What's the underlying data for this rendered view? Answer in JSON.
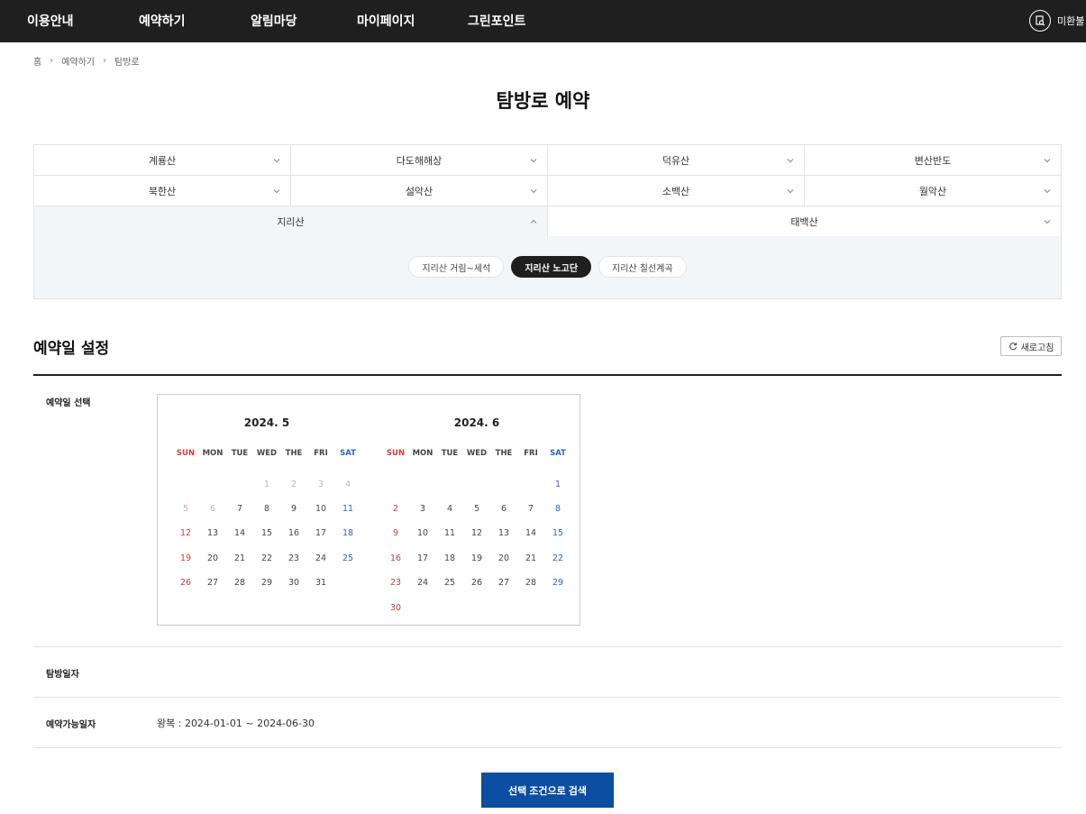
{
  "nav": {
    "items": [
      "이용안내",
      "예약하기",
      "알림마당",
      "마이페이지",
      "그린포인트"
    ],
    "user_label": "미환불"
  },
  "breadcrumb": [
    "홈",
    "예약하기",
    "탐방로"
  ],
  "page_title": "탐방로 예약",
  "mountains": {
    "rows": [
      [
        "계룡산",
        "다도해해상",
        "덕유산",
        "변산반도"
      ],
      [
        "북한산",
        "설악산",
        "소백산",
        "월악산"
      ],
      [
        "지리산",
        "태백산"
      ]
    ],
    "active": "지리산"
  },
  "sub_trails": {
    "items": [
      "지리산 거림~세석",
      "지리산 노고단",
      "지리산 칠선계곡"
    ],
    "active": "지리산 노고단"
  },
  "section": {
    "title": "예약일 설정",
    "refresh_label": "새로고침",
    "date_select_label": "예약일 선택",
    "visit_date_label": "탐방일자",
    "available_label": "예약가능일자",
    "available_value": "왕복 : 2024-01-01 ~ 2024-06-30"
  },
  "calendars": [
    {
      "title": "2024. 5",
      "weekdays": [
        "SUN",
        "MON",
        "TUE",
        "WED",
        "THE",
        "FRI",
        "SAT"
      ],
      "first_weekday": 3,
      "days": 31,
      "past_until": 6
    },
    {
      "title": "2024. 6",
      "weekdays": [
        "SUN",
        "MON",
        "TUE",
        "WED",
        "THE",
        "FRI",
        "SAT"
      ],
      "first_weekday": 6,
      "days": 30,
      "past_until": 0
    }
  ],
  "search_button": "선택 조건으로 검색",
  "colors": {
    "nav_bg": "#1f1f1f",
    "primary": "#0b4ea2",
    "sunday": "#d63a3a",
    "saturday": "#2c64c4"
  }
}
